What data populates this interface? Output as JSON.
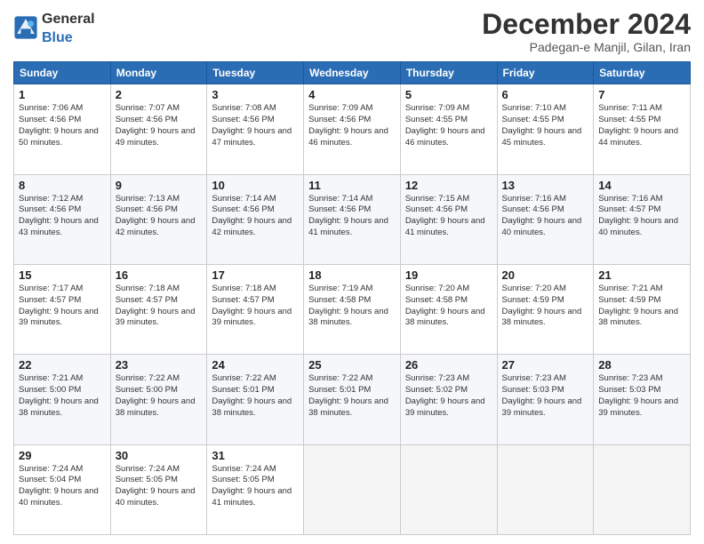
{
  "logo": {
    "general": "General",
    "blue": "Blue"
  },
  "header": {
    "month": "December 2024",
    "location": "Padegan-e Manjil, Gilan, Iran"
  },
  "weekdays": [
    "Sunday",
    "Monday",
    "Tuesday",
    "Wednesday",
    "Thursday",
    "Friday",
    "Saturday"
  ],
  "weeks": [
    [
      {
        "day": "1",
        "sunrise": "7:06 AM",
        "sunset": "4:56 PM",
        "daylight": "9 hours and 50 minutes."
      },
      {
        "day": "2",
        "sunrise": "7:07 AM",
        "sunset": "4:56 PM",
        "daylight": "9 hours and 49 minutes."
      },
      {
        "day": "3",
        "sunrise": "7:08 AM",
        "sunset": "4:56 PM",
        "daylight": "9 hours and 47 minutes."
      },
      {
        "day": "4",
        "sunrise": "7:09 AM",
        "sunset": "4:56 PM",
        "daylight": "9 hours and 46 minutes."
      },
      {
        "day": "5",
        "sunrise": "7:09 AM",
        "sunset": "4:55 PM",
        "daylight": "9 hours and 46 minutes."
      },
      {
        "day": "6",
        "sunrise": "7:10 AM",
        "sunset": "4:55 PM",
        "daylight": "9 hours and 45 minutes."
      },
      {
        "day": "7",
        "sunrise": "7:11 AM",
        "sunset": "4:55 PM",
        "daylight": "9 hours and 44 minutes."
      }
    ],
    [
      {
        "day": "8",
        "sunrise": "7:12 AM",
        "sunset": "4:56 PM",
        "daylight": "9 hours and 43 minutes."
      },
      {
        "day": "9",
        "sunrise": "7:13 AM",
        "sunset": "4:56 PM",
        "daylight": "9 hours and 42 minutes."
      },
      {
        "day": "10",
        "sunrise": "7:14 AM",
        "sunset": "4:56 PM",
        "daylight": "9 hours and 42 minutes."
      },
      {
        "day": "11",
        "sunrise": "7:14 AM",
        "sunset": "4:56 PM",
        "daylight": "9 hours and 41 minutes."
      },
      {
        "day": "12",
        "sunrise": "7:15 AM",
        "sunset": "4:56 PM",
        "daylight": "9 hours and 41 minutes."
      },
      {
        "day": "13",
        "sunrise": "7:16 AM",
        "sunset": "4:56 PM",
        "daylight": "9 hours and 40 minutes."
      },
      {
        "day": "14",
        "sunrise": "7:16 AM",
        "sunset": "4:57 PM",
        "daylight": "9 hours and 40 minutes."
      }
    ],
    [
      {
        "day": "15",
        "sunrise": "7:17 AM",
        "sunset": "4:57 PM",
        "daylight": "9 hours and 39 minutes."
      },
      {
        "day": "16",
        "sunrise": "7:18 AM",
        "sunset": "4:57 PM",
        "daylight": "9 hours and 39 minutes."
      },
      {
        "day": "17",
        "sunrise": "7:18 AM",
        "sunset": "4:57 PM",
        "daylight": "9 hours and 39 minutes."
      },
      {
        "day": "18",
        "sunrise": "7:19 AM",
        "sunset": "4:58 PM",
        "daylight": "9 hours and 38 minutes."
      },
      {
        "day": "19",
        "sunrise": "7:20 AM",
        "sunset": "4:58 PM",
        "daylight": "9 hours and 38 minutes."
      },
      {
        "day": "20",
        "sunrise": "7:20 AM",
        "sunset": "4:59 PM",
        "daylight": "9 hours and 38 minutes."
      },
      {
        "day": "21",
        "sunrise": "7:21 AM",
        "sunset": "4:59 PM",
        "daylight": "9 hours and 38 minutes."
      }
    ],
    [
      {
        "day": "22",
        "sunrise": "7:21 AM",
        "sunset": "5:00 PM",
        "daylight": "9 hours and 38 minutes."
      },
      {
        "day": "23",
        "sunrise": "7:22 AM",
        "sunset": "5:00 PM",
        "daylight": "9 hours and 38 minutes."
      },
      {
        "day": "24",
        "sunrise": "7:22 AM",
        "sunset": "5:01 PM",
        "daylight": "9 hours and 38 minutes."
      },
      {
        "day": "25",
        "sunrise": "7:22 AM",
        "sunset": "5:01 PM",
        "daylight": "9 hours and 38 minutes."
      },
      {
        "day": "26",
        "sunrise": "7:23 AM",
        "sunset": "5:02 PM",
        "daylight": "9 hours and 39 minutes."
      },
      {
        "day": "27",
        "sunrise": "7:23 AM",
        "sunset": "5:03 PM",
        "daylight": "9 hours and 39 minutes."
      },
      {
        "day": "28",
        "sunrise": "7:23 AM",
        "sunset": "5:03 PM",
        "daylight": "9 hours and 39 minutes."
      }
    ],
    [
      {
        "day": "29",
        "sunrise": "7:24 AM",
        "sunset": "5:04 PM",
        "daylight": "9 hours and 40 minutes."
      },
      {
        "day": "30",
        "sunrise": "7:24 AM",
        "sunset": "5:05 PM",
        "daylight": "9 hours and 40 minutes."
      },
      {
        "day": "31",
        "sunrise": "7:24 AM",
        "sunset": "5:05 PM",
        "daylight": "9 hours and 41 minutes."
      },
      null,
      null,
      null,
      null
    ]
  ]
}
